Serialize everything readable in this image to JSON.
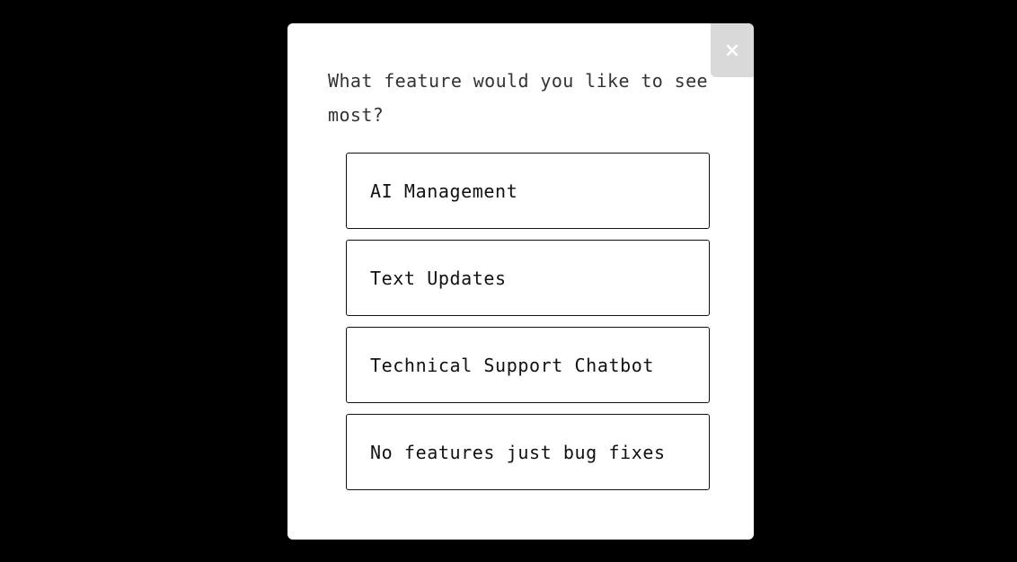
{
  "modal": {
    "close_label": "×",
    "question": "What feature would you like to see most?",
    "options": [
      {
        "label": "AI Management"
      },
      {
        "label": "Text Updates"
      },
      {
        "label": "Technical Support Chatbot"
      },
      {
        "label": "No features just bug fixes"
      }
    ]
  },
  "colors": {
    "backdrop": "#000000",
    "modal_background": "#ffffff",
    "close_button_background": "#d9d9d9",
    "option_border": "#111111"
  }
}
